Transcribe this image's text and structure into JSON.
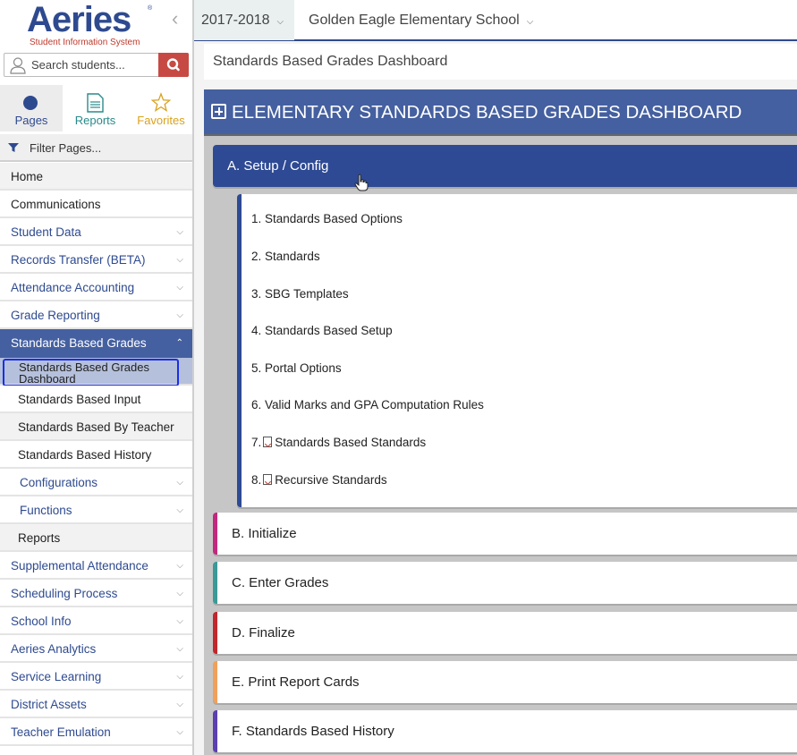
{
  "logo": {
    "brand": "Aeries",
    "registered": "®",
    "tagline": "Student Information System"
  },
  "search": {
    "placeholder": "Search students..."
  },
  "sidebar_tabs": [
    {
      "label": "Pages",
      "icon": "circle-icon"
    },
    {
      "label": "Reports",
      "icon": "document-icon"
    },
    {
      "label": "Favorites",
      "icon": "star-icon"
    }
  ],
  "filter": {
    "placeholder": "Filter Pages..."
  },
  "nav": {
    "home": "Home",
    "communications": "Communications",
    "student_data": "Student Data",
    "records_transfer": "Records Transfer (BETA)",
    "attendance_accounting": "Attendance Accounting",
    "grade_reporting": "Grade Reporting",
    "standards_based_grades": "Standards Based Grades",
    "sbg_children": {
      "dashboard_line1": "Standards Based Grades",
      "dashboard_line2": "Dashboard",
      "input": "Standards Based Input",
      "by_teacher": "Standards Based By Teacher",
      "history": "Standards Based History",
      "configurations": "Configurations",
      "functions": "Functions",
      "reports": "Reports"
    },
    "supplemental_attendance": "Supplemental Attendance",
    "scheduling_process": "Scheduling Process",
    "school_info": "School Info",
    "aeries_analytics": "Aeries Analytics",
    "service_learning": "Service Learning",
    "district_assets": "District Assets",
    "teacher_emulation": "Teacher Emulation"
  },
  "topbar": {
    "year": "2017-2018",
    "school": "Golden Eagle Elementary School"
  },
  "breadcrumb": "Standards Based Grades Dashboard",
  "dashboard": {
    "title": "ELEMENTARY STANDARDS BASED GRADES DASHBOARD",
    "sections": [
      {
        "label": "A. Setup / Config",
        "color": "#2e4a94",
        "expanded": true
      },
      {
        "label": "B. Initialize",
        "color": "#c2287e"
      },
      {
        "label": "C. Enter Grades",
        "color": "#3a9a98"
      },
      {
        "label": "D. Finalize",
        "color": "#c1272d"
      },
      {
        "label": "E. Print Report Cards",
        "color": "#f0a05a"
      },
      {
        "label": "F. Standards Based History",
        "color": "#5c3fb0"
      }
    ],
    "setup_items": [
      {
        "num": "1.",
        "label": "Standards Based Options"
      },
      {
        "num": "2.",
        "label": "Standards"
      },
      {
        "num": "3.",
        "label": "SBG Templates"
      },
      {
        "num": "4.",
        "label": "Standards Based Setup"
      },
      {
        "num": "5.",
        "label": "Portal Options"
      },
      {
        "num": "6.",
        "label": "Valid Marks and GPA Computation Rules"
      },
      {
        "num": "7.",
        "label": "Standards Based Standards",
        "pdf": true
      },
      {
        "num": "8.",
        "label": "Recursive Standards",
        "pdf": true
      }
    ]
  }
}
